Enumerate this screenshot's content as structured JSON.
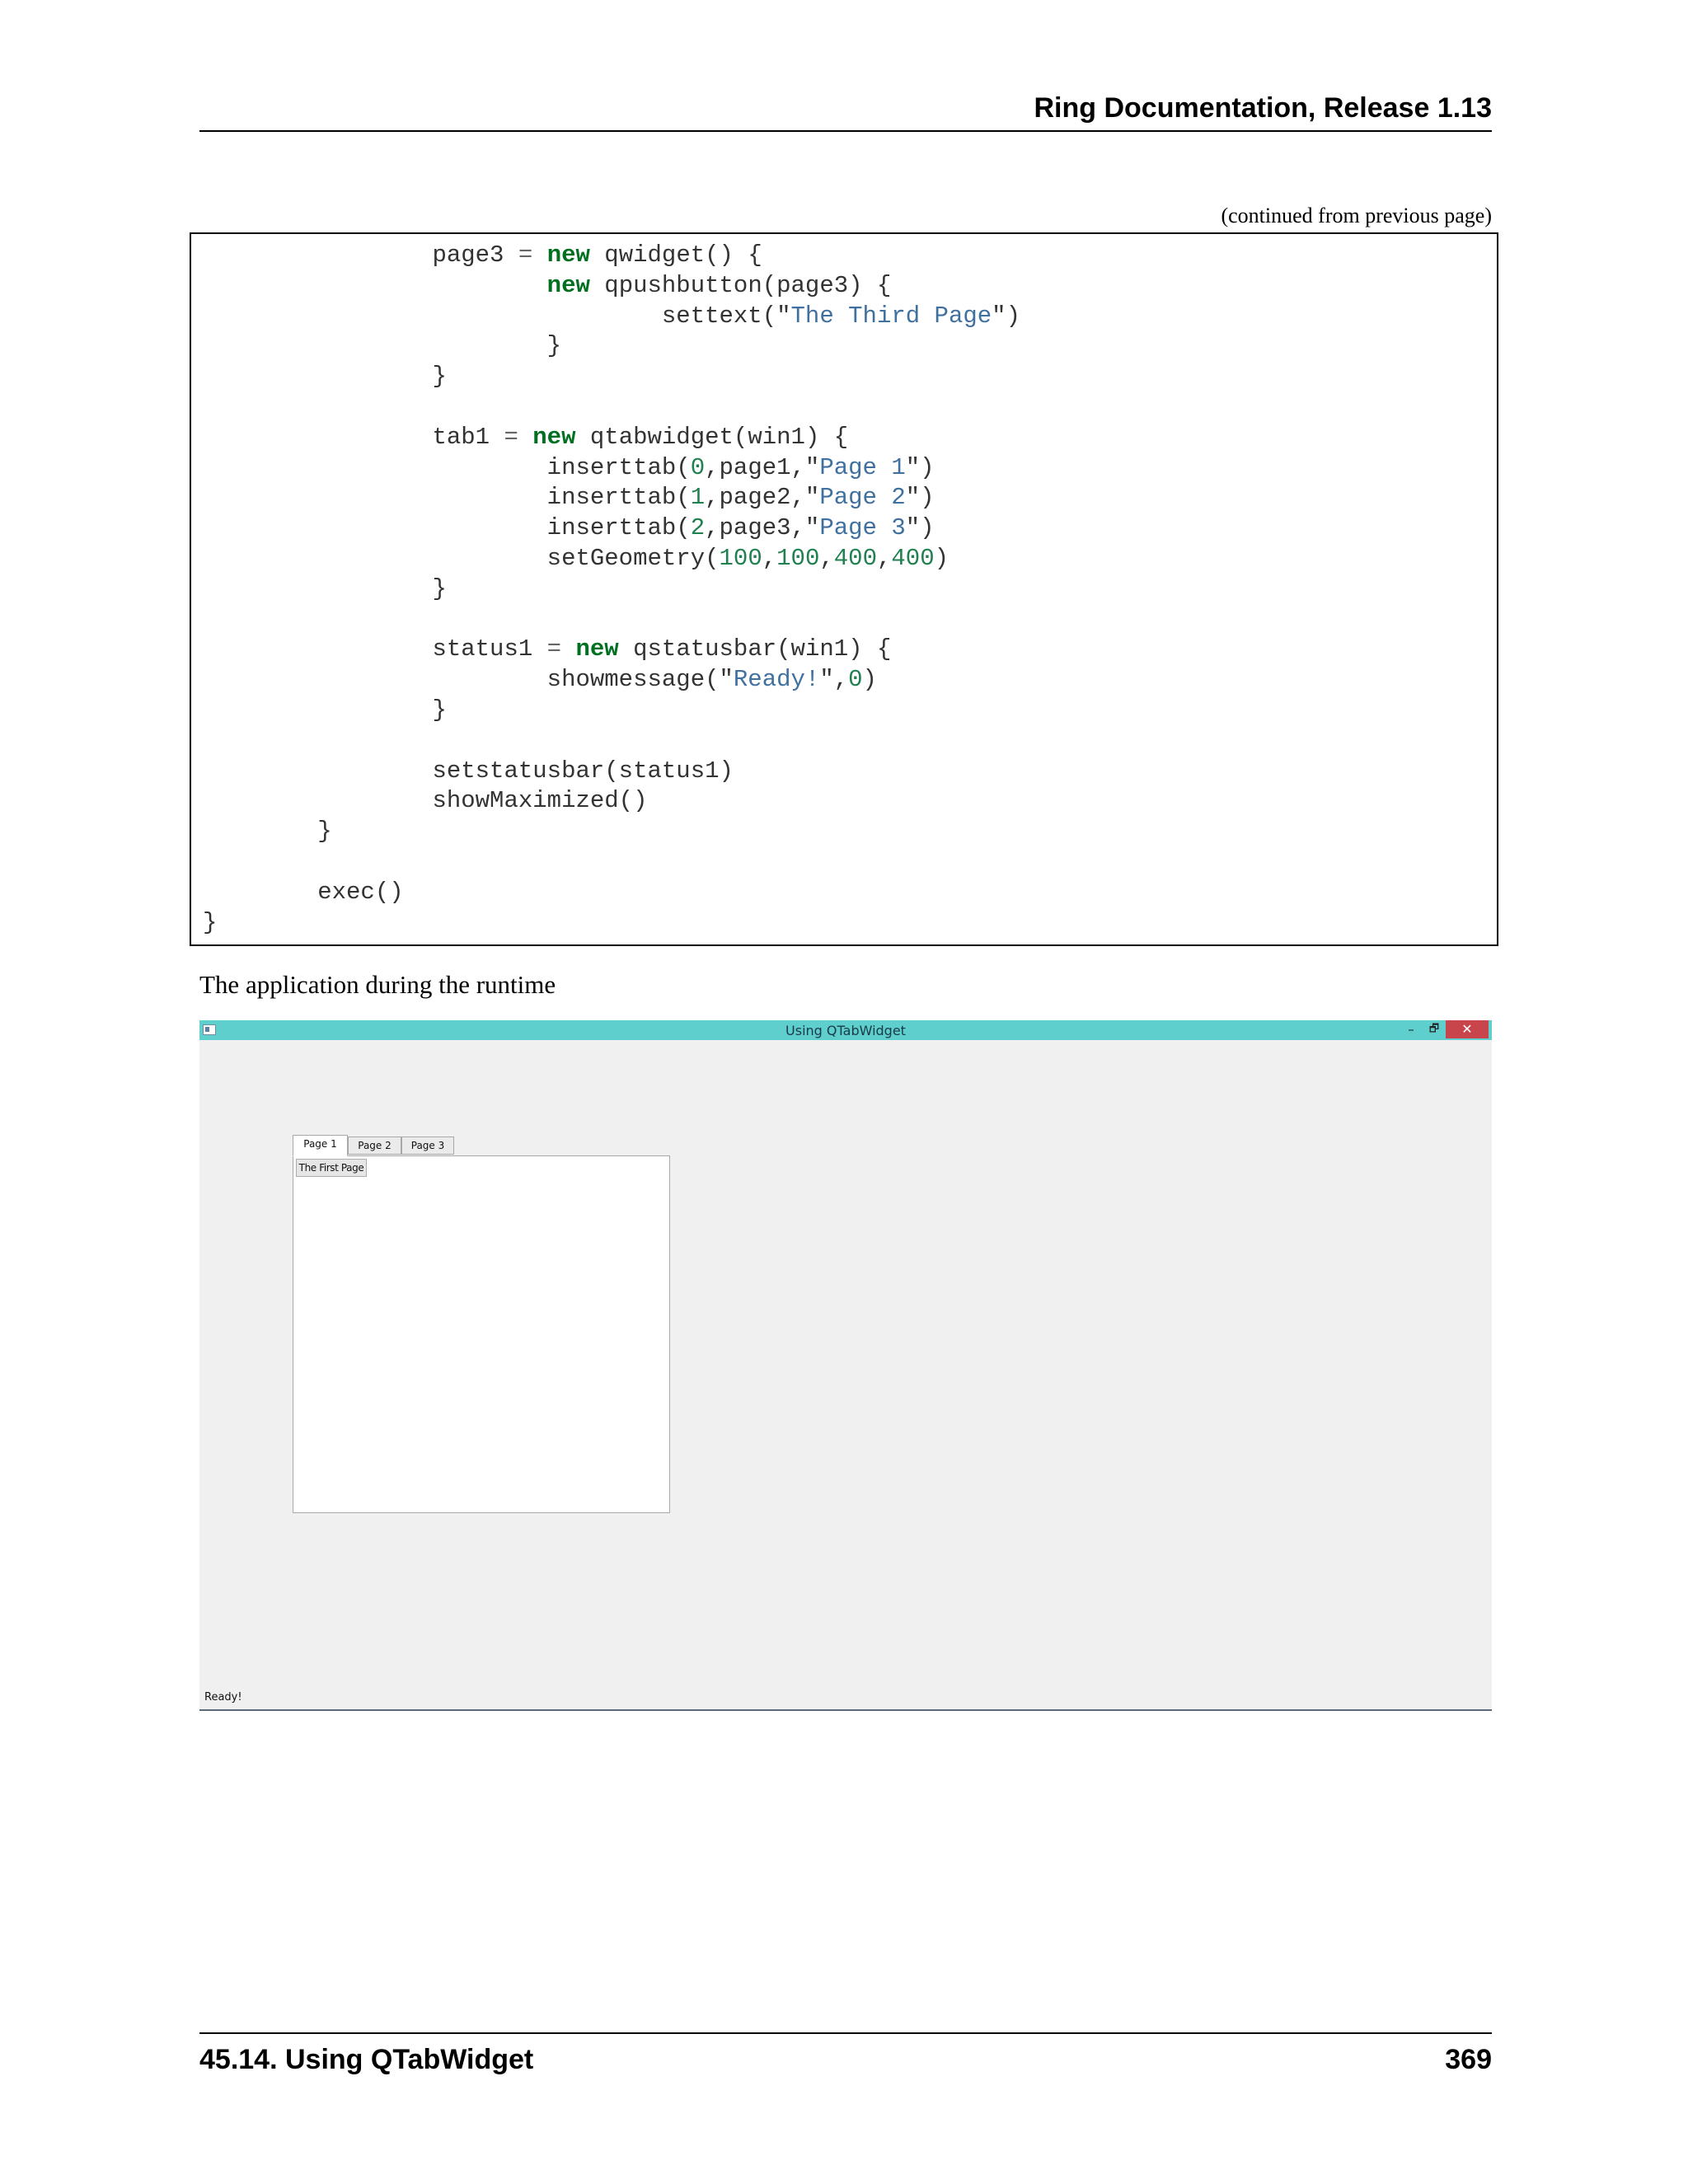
{
  "header": {
    "title": "Ring Documentation, Release 1.13"
  },
  "continued_note": "(continued from previous page)",
  "code": {
    "l1_var": "                page3 ",
    "l1_eq": "=",
    "l1_sp": " ",
    "l1_kw": "new",
    "l1_rest": " qwidget() {",
    "l2_indent": "                        ",
    "l2_kw": "new",
    "l2_rest": " qpushbutton(page3) {",
    "l3_pre": "                                settext(\"",
    "l3_str": "The Third Page",
    "l3_post": "\")",
    "l4": "                        }",
    "l5": "                }",
    "l6": "",
    "l7_var": "                tab1 ",
    "l7_eq": "=",
    "l7_sp": " ",
    "l7_kw": "new",
    "l7_rest": " qtabwidget(win1) {",
    "l8_pre": "                        inserttab(",
    "l8_num": "0",
    "l8_mid": ",page1,\"",
    "l8_str": "Page 1",
    "l8_post": "\")",
    "l9_pre": "                        inserttab(",
    "l9_num": "1",
    "l9_mid": ",page2,\"",
    "l9_str": "Page 2",
    "l9_post": "\")",
    "l10_pre": "                        inserttab(",
    "l10_num": "2",
    "l10_mid": ",page3,\"",
    "l10_str": "Page 3",
    "l10_post": "\")",
    "l11_pre": "                        setGeometry(",
    "l11_n1": "100",
    "l11_c1": ",",
    "l11_n2": "100",
    "l11_c2": ",",
    "l11_n3": "400",
    "l11_c3": ",",
    "l11_n4": "400",
    "l11_post": ")",
    "l12": "                }",
    "l13": "",
    "l14_var": "                status1 ",
    "l14_eq": "=",
    "l14_sp": " ",
    "l14_kw": "new",
    "l14_rest": " qstatusbar(win1) {",
    "l15_pre": "                        showmessage(\"",
    "l15_str": "Ready!",
    "l15_mid": "\",",
    "l15_num": "0",
    "l15_post": ")",
    "l16": "                }",
    "l17": "",
    "l18": "                setstatusbar(status1)",
    "l19": "                showMaximized()",
    "l20": "        }",
    "l21": "",
    "l22": "        exec()",
    "l23": "}"
  },
  "paragraph": "The application during the runtime",
  "app": {
    "window_title": "Using QTabWidget",
    "minimize_glyph": "–",
    "maximize_glyph": "🗗",
    "close_glyph": "✕",
    "tabs": [
      {
        "label": "Page 1"
      },
      {
        "label": "Page 2"
      },
      {
        "label": "Page 3"
      }
    ],
    "button_label": "The First Page",
    "status_message": "Ready!"
  },
  "footer": {
    "section": "45.14.  Using QTabWidget",
    "page_number": "369"
  }
}
